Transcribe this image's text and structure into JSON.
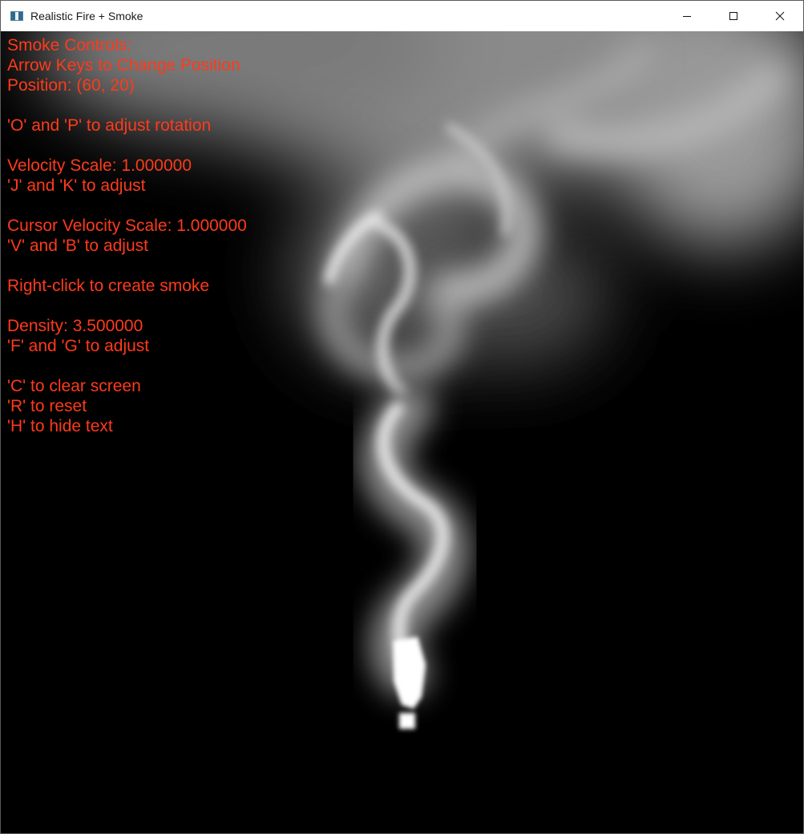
{
  "window": {
    "title": "Realistic Fire + Smoke",
    "icon": "app-window-icon",
    "controls": {
      "minimize_icon": "minimize-icon",
      "maximize_icon": "maximize-icon",
      "close_icon": "close-icon"
    }
  },
  "overlay": {
    "color": "#ff3a1a",
    "lines": [
      "Smoke Controls:",
      "Arrow Keys to Change Position",
      "Position: (60, 20)",
      "",
      "'O' and 'P' to adjust rotation",
      "",
      "Velocity Scale: 1.000000",
      "'J' and 'K' to adjust",
      "",
      "Cursor Velocity Scale: 1.000000",
      "'V' and 'B' to adjust",
      "",
      "Right-click to create smoke",
      "",
      "Density: 3.500000",
      "'F' and 'G' to adjust",
      "",
      "'C' to clear screen",
      "'R' to reset",
      "'H' to hide text"
    ]
  },
  "canvas": {
    "background": "#000000",
    "smoke_color": "#ffffff"
  }
}
